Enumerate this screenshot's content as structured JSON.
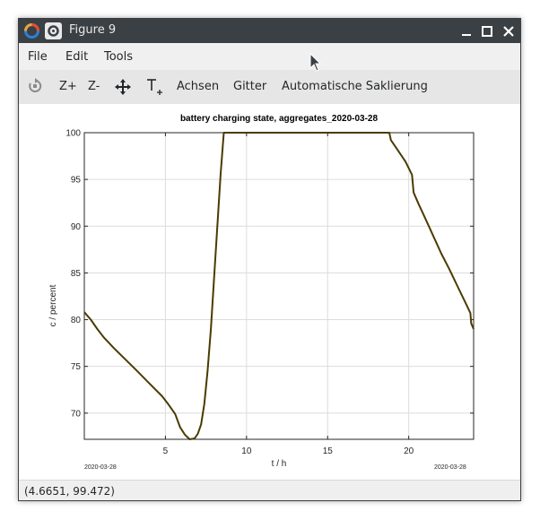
{
  "window": {
    "title": "Figure 9"
  },
  "menu": [
    "File",
    "Edit",
    "Tools"
  ],
  "toolbar": {
    "zoom_in": "Z+",
    "zoom_out": "Z-",
    "axes": "Achsen",
    "grid": "Gitter",
    "autoscale": "Automatische Saklierung"
  },
  "status": {
    "coords": "(4.6651, 99.472)"
  },
  "colors": {
    "titlebar": "#3b4045",
    "line": "#4a3b00"
  },
  "chart_data": {
    "type": "line",
    "title": "battery charging state, aggregates_2020-03-28",
    "xlabel": "t / h",
    "ylabel": "c / percent",
    "xlim": [
      0,
      24
    ],
    "ylim": [
      67.2,
      100
    ],
    "xticks": [
      5,
      10,
      15,
      20
    ],
    "yticks": [
      70,
      75,
      80,
      85,
      90,
      95,
      100
    ],
    "x_date_left": "2020-03-28",
    "x_date_right": "2020-03-28",
    "grid": true,
    "series": [
      {
        "x": [
          0,
          0.4,
          0.8,
          1.2,
          1.8,
          2.5,
          3.2,
          4.0,
          4.8,
          5.2,
          5.6,
          5.9,
          6.2,
          6.5,
          6.8,
          7.0,
          7.2,
          7.4,
          7.6,
          7.8,
          8.0,
          8.2,
          8.4,
          8.6,
          9.0,
          12,
          15,
          18,
          18.8,
          18.9,
          19.3,
          19.8,
          20.2,
          20.3,
          20.6,
          21.0,
          21.5,
          22.0,
          22.5,
          23.0,
          23.5,
          23.8,
          23.85,
          24.0
        ],
        "y": [
          80.8,
          80.0,
          79.0,
          78.1,
          77.0,
          75.8,
          74.6,
          73.2,
          71.8,
          70.9,
          69.9,
          68.5,
          67.7,
          67.2,
          67.3,
          67.8,
          68.8,
          71.0,
          74.5,
          79.0,
          84.5,
          90.0,
          95.5,
          100,
          100,
          100,
          100,
          100,
          100,
          99.2,
          98.2,
          96.9,
          95.5,
          93.6,
          92.4,
          90.9,
          89.0,
          87.1,
          85.4,
          83.6,
          81.8,
          80.7,
          79.6,
          79.0
        ]
      }
    ]
  }
}
